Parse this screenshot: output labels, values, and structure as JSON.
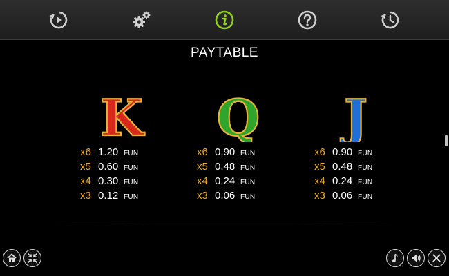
{
  "toolbar": {
    "icons": [
      "replay-icon",
      "settings-icon",
      "info-icon",
      "help-icon",
      "history-icon"
    ],
    "active": "info-icon",
    "active_color": "#8fd11d"
  },
  "title": "PAYTABLE",
  "symbols": [
    {
      "letter": "K",
      "color": "#d7281c",
      "rows": [
        {
          "mult": "x6",
          "value": "1.20",
          "currency": "FUN"
        },
        {
          "mult": "x5",
          "value": "0.60",
          "currency": "FUN"
        },
        {
          "mult": "x4",
          "value": "0.30",
          "currency": "FUN"
        },
        {
          "mult": "x3",
          "value": "0.12",
          "currency": "FUN"
        }
      ]
    },
    {
      "letter": "Q",
      "color": "#2fa52b",
      "rows": [
        {
          "mult": "x6",
          "value": "0.90",
          "currency": "FUN"
        },
        {
          "mult": "x5",
          "value": "0.48",
          "currency": "FUN"
        },
        {
          "mult": "x4",
          "value": "0.24",
          "currency": "FUN"
        },
        {
          "mult": "x3",
          "value": "0.06",
          "currency": "FUN"
        }
      ]
    },
    {
      "letter": "J",
      "color": "#1f6fd6",
      "rows": [
        {
          "mult": "x6",
          "value": "0.90",
          "currency": "FUN"
        },
        {
          "mult": "x5",
          "value": "0.48",
          "currency": "FUN"
        },
        {
          "mult": "x4",
          "value": "0.24",
          "currency": "FUN"
        },
        {
          "mult": "x3",
          "value": "0.06",
          "currency": "FUN"
        }
      ]
    }
  ],
  "accent_color": "#f0a81e",
  "bottom_left_icons": [
    "home-icon",
    "minimize-icon"
  ],
  "bottom_right_icons": [
    "music-icon",
    "sound-icon",
    "close-icon"
  ]
}
